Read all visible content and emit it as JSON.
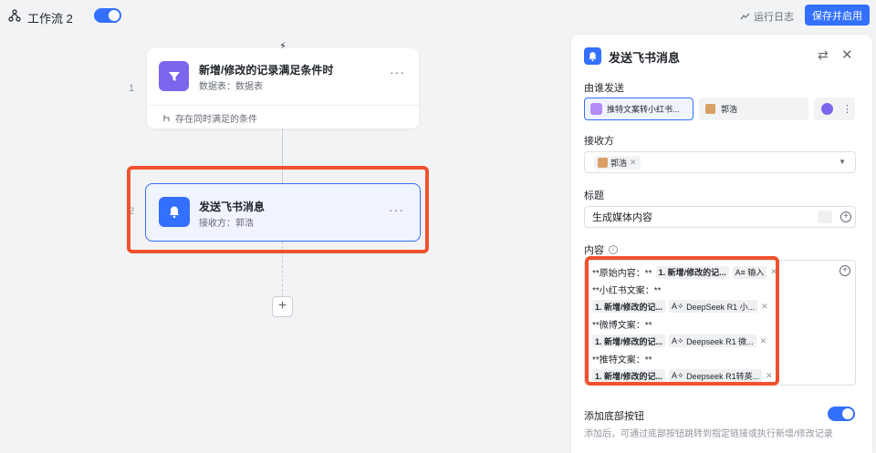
{
  "topbar": {
    "title": "工作流 2",
    "run_log": "运行日志",
    "save_label": "保存并启用"
  },
  "canvas": {
    "step1": {
      "number": "1",
      "title": "新增/修改的记录满足条件时",
      "subtitle": "数据表：数据表",
      "condition": "存在同时满足的条件"
    },
    "step2": {
      "number": "2",
      "title": "发送飞书消息",
      "subtitle": "接收方：郭浩"
    },
    "more": "···",
    "add": "+"
  },
  "panel": {
    "title": "发送飞书消息",
    "sender_label": "由谁发送",
    "sender_selected": "推特文案转小红书...",
    "sender_other": "郭浩",
    "receiver_label": "接收方",
    "receiver_tag": "郭浩",
    "subject_label": "标题",
    "subject_value": "生成媒体内容",
    "content_label": "内容",
    "content_lines": [
      {
        "text": "**原始内容：**",
        "chip1": "1. 新增/修改的记...",
        "chip2": "输入"
      },
      {
        "text": "**小红书文案：**"
      },
      {
        "chip1": "1. 新增/修改的记...",
        "chip2": "DeepSeek R1 小..."
      },
      {
        "text": "**微博文案：**"
      },
      {
        "chip1": "1. 新增/修改的记...",
        "chip2": "Deepseek R1 微..."
      },
      {
        "text": "**推特文案：**"
      },
      {
        "chip1": "1. 新增/修改的记...",
        "chip2": "Deepseek R1转英..."
      }
    ],
    "bottom_button_label": "添加底部按钮",
    "bottom_button_hint": "添加后，可通过底部按钮跳转到指定链接或执行新增/修改记录"
  },
  "colors": {
    "accent": "#3370ff",
    "trigger": "#7b67ee",
    "highlight": "#f0522d"
  }
}
